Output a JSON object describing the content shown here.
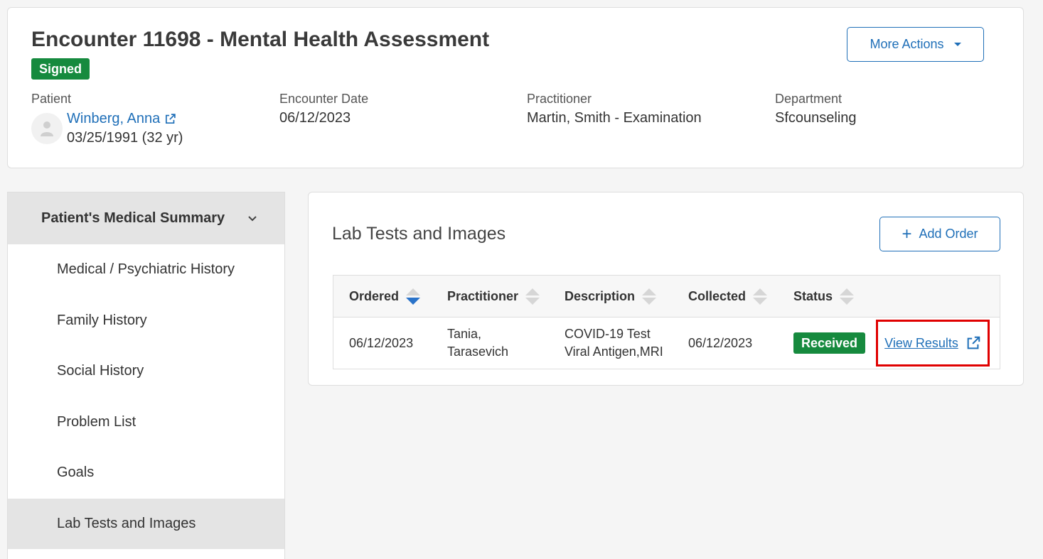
{
  "header": {
    "title": "Encounter 11698 - Mental Health Assessment",
    "status": "Signed",
    "more_actions_label": "More Actions",
    "patient": {
      "label": "Patient",
      "name": "Winberg, Anna",
      "dob": "03/25/1991 (32 yr)"
    },
    "encounter_date": {
      "label": "Encounter Date",
      "value": "06/12/2023"
    },
    "practitioner": {
      "label": "Practitioner",
      "value": "Martin, Smith - Examination"
    },
    "department": {
      "label": "Department",
      "value": "Sfcounseling"
    }
  },
  "sidebar": {
    "header": "Patient's Medical Summary",
    "items": [
      {
        "label": "Medical / Psychiatric History",
        "active": false
      },
      {
        "label": "Family History",
        "active": false
      },
      {
        "label": "Social History",
        "active": false
      },
      {
        "label": "Problem List",
        "active": false
      },
      {
        "label": "Goals",
        "active": false
      },
      {
        "label": "Lab Tests and Images",
        "active": true
      }
    ]
  },
  "main": {
    "title": "Lab Tests and Images",
    "add_order_label": "Add Order",
    "table": {
      "columns": [
        "Ordered",
        "Practitioner",
        "Description",
        "Collected",
        "Status"
      ],
      "sorted_column": "Ordered",
      "rows": [
        {
          "ordered": "06/12/2023",
          "practitioner_line1": "Tania,",
          "practitioner_line2": "Tarasevich",
          "description_line1": "COVID-19 Test",
          "description_line2": "Viral Antigen,MRI",
          "collected": "06/12/2023",
          "status": "Received",
          "action_label": "View Results"
        }
      ]
    }
  },
  "colors": {
    "accent": "#1f6fb8",
    "success": "#168a3e",
    "highlight": "#e00000"
  }
}
